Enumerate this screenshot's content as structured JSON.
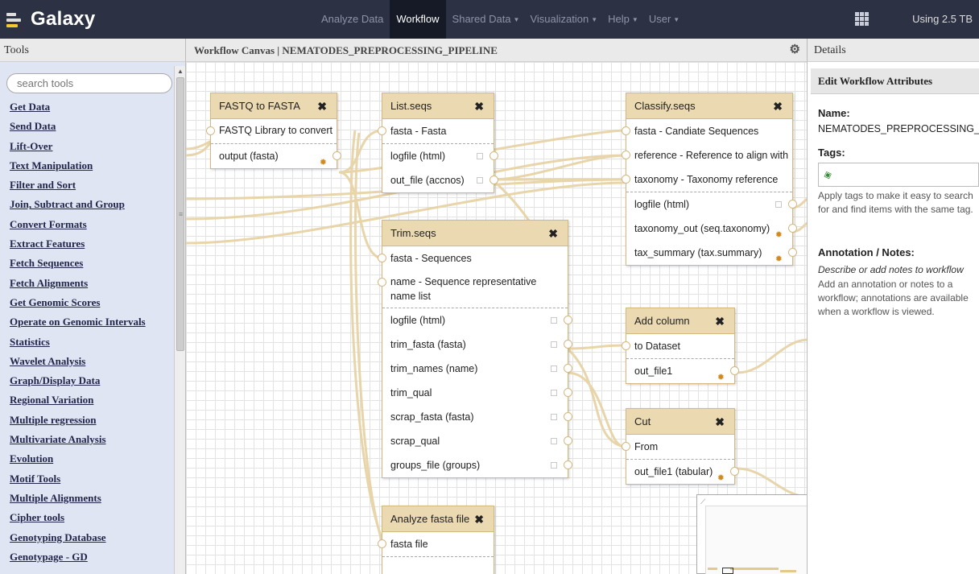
{
  "brand": {
    "name": "Galaxy"
  },
  "nav": [
    {
      "label": "Analyze Data",
      "caret": false
    },
    {
      "label": "Workflow",
      "caret": false
    },
    {
      "label": "Shared Data",
      "caret": true
    },
    {
      "label": "Visualization",
      "caret": true
    },
    {
      "label": "Help",
      "caret": true
    },
    {
      "label": "User",
      "caret": true
    }
  ],
  "quota": "Using 2.5 TB",
  "tools": {
    "header": "Tools",
    "search_placeholder": "search tools",
    "sections": [
      "Get Data",
      "Send Data",
      "Lift-Over",
      "Text Manipulation",
      "Filter and Sort",
      "Join, Subtract and Group",
      "Convert Formats",
      "Extract Features",
      "Fetch Sequences",
      "Fetch Alignments",
      "Get Genomic Scores",
      "Operate on Genomic Intervals",
      "Statistics",
      "Wavelet Analysis",
      "Graph/Display Data",
      "Regional Variation",
      "Multiple regression",
      "Multivariate Analysis",
      "Evolution",
      "Motif Tools",
      "Multiple Alignments",
      "Cipher tools",
      "Genotyping Database",
      "Genotypage - GD"
    ]
  },
  "canvas": {
    "header": "Workflow Canvas | NEMATODES_PREPROCESSING_PIPELINE",
    "nodes": {
      "fastq": {
        "title": "FASTQ to FASTA",
        "inputs": [
          "FASTQ Library to convert"
        ],
        "outputs": [
          "output (fasta)"
        ]
      },
      "list": {
        "title": "List.seqs",
        "inputs": [
          "fasta - Fasta"
        ],
        "outputs": [
          "logfile (html)",
          "out_file (accnos)"
        ]
      },
      "classify": {
        "title": "Classify.seqs",
        "inputs": [
          "fasta - Candiate Sequences",
          "reference - Reference to align with",
          "taxonomy - Taxonomy reference"
        ],
        "outputs": [
          "logfile (html)",
          "taxonomy_out (seq.taxonomy)",
          "tax_summary (tax.summary)"
        ]
      },
      "trim": {
        "title": "Trim.seqs",
        "inputs": [
          "fasta - Sequences",
          "name - Sequence representative name list"
        ],
        "outputs": [
          "logfile (html)",
          "trim_fasta (fasta)",
          "trim_names (name)",
          "trim_qual",
          "scrap_fasta (fasta)",
          "scrap_qual",
          "groups_file (groups)"
        ]
      },
      "addcol": {
        "title": "Add column",
        "inputs": [
          "to Dataset"
        ],
        "outputs": [
          "out_file1"
        ]
      },
      "cut": {
        "title": "Cut",
        "inputs": [
          "From"
        ],
        "outputs": [
          "out_file1 (tabular)"
        ]
      },
      "analyze": {
        "title": "Analyze fasta file",
        "inputs": [
          "fasta file"
        ],
        "outputs": []
      }
    }
  },
  "details": {
    "header": "Details",
    "title": "Edit Workflow Attributes",
    "name_label": "Name:",
    "name_value": "NEMATODES_PREPROCESSING_PIPELINE",
    "tags_label": "Tags:",
    "tags_help": "Apply tags to make it easy to search for and find items with the same tag.",
    "annotation_label": "Annotation / Notes:",
    "annotation_placeholder": "Describe or add notes to workflow",
    "annotation_help": "Add an annotation or notes to a workflow; annotations are available when a workflow is viewed."
  },
  "colors": {
    "masthead": "#2c3143",
    "node_header": "#ebd9b2",
    "wire": "#e8d3a6",
    "tool_panel": "#dfe5f2"
  },
  "icons": [
    "galaxy-logo-icon",
    "apps-grid-icon",
    "gear-icon",
    "close-icon",
    "tag-icon",
    "star-output-icon"
  ]
}
